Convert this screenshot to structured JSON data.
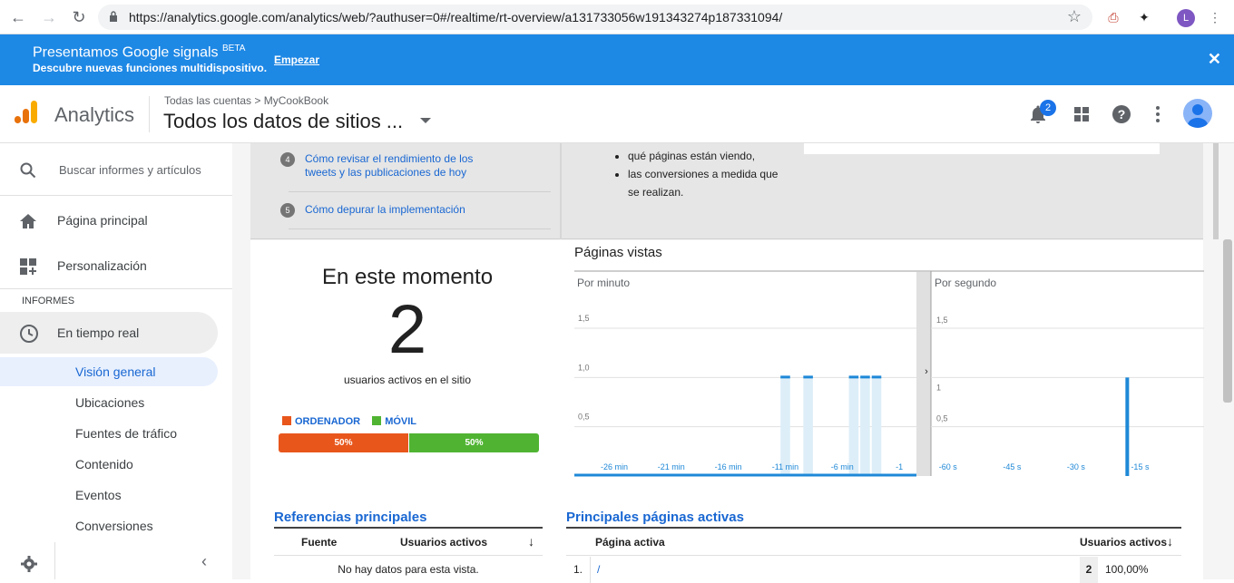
{
  "browser": {
    "url": "https://analytics.google.com/analytics/web/?authuser=0#/realtime/rt-overview/a131733056w191343274p187331094/",
    "profile_initial": "L"
  },
  "banner": {
    "title": "Presentamos Google signals",
    "beta": "BETA",
    "subtitle": "Descubre nuevas funciones multidispositivo.",
    "link": "Empezar",
    "color": "#1e88e5"
  },
  "header": {
    "app_name": "Analytics",
    "breadcrumb": "Todas las cuentas > MyCookBook",
    "property": "Todos los datos de sitios ...",
    "notifications": "2"
  },
  "sidebar": {
    "search_placeholder": "Buscar informes y artículos",
    "home": "Página principal",
    "customization": "Personalización",
    "section": "INFORMES",
    "realtime": "En tiempo real",
    "sub_items": [
      "Visión general",
      "Ubicaciones",
      "Fuentes de tráfico",
      "Contenido",
      "Eventos",
      "Conversiones"
    ]
  },
  "tips": [
    {
      "num": "4",
      "text": "Cómo revisar el rendimiento de los tweets y las publicaciones de hoy"
    },
    {
      "num": "5",
      "text": "Cómo depurar la implementación"
    }
  ],
  "bullets": [
    "qué páginas están viendo,",
    "las conversiones a medida que se realizan."
  ],
  "now": {
    "title": "En este momento",
    "count": "2",
    "subtitle": "usuarios activos en el sitio",
    "legend_desktop": "ORDENADOR",
    "legend_mobile": "MÓVIL",
    "desktop_pct": "50%",
    "mobile_pct": "50%",
    "desktop_color": "#e8561c",
    "mobile_color": "#50b432"
  },
  "pageviews_title": "Páginas vistas",
  "chart_data": [
    {
      "type": "bar",
      "title": "Por minuto",
      "x": [
        "-29 min",
        "-28 min",
        "-27 min",
        "-26 min",
        "-25 min",
        "-24 min",
        "-23 min",
        "-22 min",
        "-21 min",
        "-20 min",
        "-19 min",
        "-18 min",
        "-17 min",
        "-16 min",
        "-15 min",
        "-14 min",
        "-13 min",
        "-12 min",
        "-11 min",
        "-10 min",
        "-9 min",
        "-8 min",
        "-7 min",
        "-6 min",
        "-5 min",
        "-4 min",
        "-3 min",
        "-2 min",
        "-1 min",
        "0 min"
      ],
      "x_tick_labels": [
        "-26 min",
        "-21 min",
        "-16 min",
        "-11 min",
        "-6 min",
        "-1"
      ],
      "values": [
        0,
        0,
        0,
        0,
        0,
        0,
        0,
        0,
        0,
        0,
        0,
        0,
        0,
        0,
        0,
        0,
        0,
        0,
        1,
        0,
        1,
        0,
        0,
        0,
        1,
        1,
        1,
        0,
        0,
        0
      ],
      "y_ticks": [
        "0,5",
        "1,0",
        "1,5"
      ],
      "ylim": [
        0,
        2
      ],
      "color": "#1e88d7"
    },
    {
      "type": "bar",
      "title": "Por segundo",
      "x_tick_labels": [
        "-60 s",
        "-45 s",
        "-30 s",
        "-15 s"
      ],
      "spike_at_seconds": -18,
      "values": [
        1
      ],
      "y_ticks": [
        "0,5",
        "1",
        "1,5"
      ],
      "ylim": [
        0,
        2
      ],
      "color": "#1e88d7"
    }
  ],
  "referrals": {
    "title": "Referencias principales",
    "col_source": "Fuente",
    "col_users": "Usuarios activos",
    "empty": "No hay datos para esta vista."
  },
  "top_pages": {
    "title": "Principales páginas activas",
    "col_page": "Página activa",
    "col_users": "Usuarios activos",
    "rows": [
      {
        "rank": "1.",
        "page": "/",
        "users": "2",
        "pct": "100,00%"
      }
    ]
  }
}
